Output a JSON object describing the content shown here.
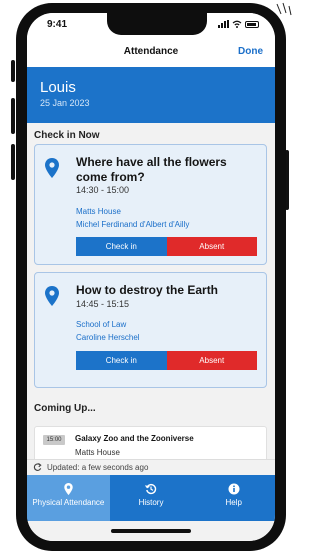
{
  "status_bar": {
    "time": "9:41"
  },
  "navbar": {
    "title": "Attendance",
    "done_label": "Done"
  },
  "profile": {
    "name": "Louis",
    "date": "25 Jan 2023"
  },
  "check_in_section": {
    "title": "Check in Now",
    "events": [
      {
        "title": "Where have all the flowers come from?",
        "time": "14:30 - 15:00",
        "location": "Matts House",
        "host": "Michel Ferdinand d'Albert d'Ailly",
        "check_in_label": "Check in",
        "absent_label": "Absent"
      },
      {
        "title": "How to destroy the Earth",
        "time": "14:45 - 15:15",
        "location": "School of Law",
        "host": "Caroline Herschel",
        "check_in_label": "Check in",
        "absent_label": "Absent"
      }
    ]
  },
  "coming_up_section": {
    "title": "Coming Up...",
    "items": [
      {
        "time": "15:00",
        "title": "Galaxy Zoo and the Zooniverse",
        "location": "Matts House"
      }
    ]
  },
  "update_status": {
    "text": "Updated: a few seconds ago",
    "icon": "refresh-icon"
  },
  "tabs": [
    {
      "label": "Physical Attendance",
      "icon": "location-pin-icon",
      "active": true
    },
    {
      "label": "History",
      "icon": "history-icon",
      "active": false
    },
    {
      "label": "Help",
      "icon": "info-icon",
      "active": false
    }
  ],
  "colors": {
    "primary": "#1c73c9",
    "absent": "#e02a2a",
    "card_bg": "#e7f0f9",
    "active_tab": "#5a9fe0"
  }
}
